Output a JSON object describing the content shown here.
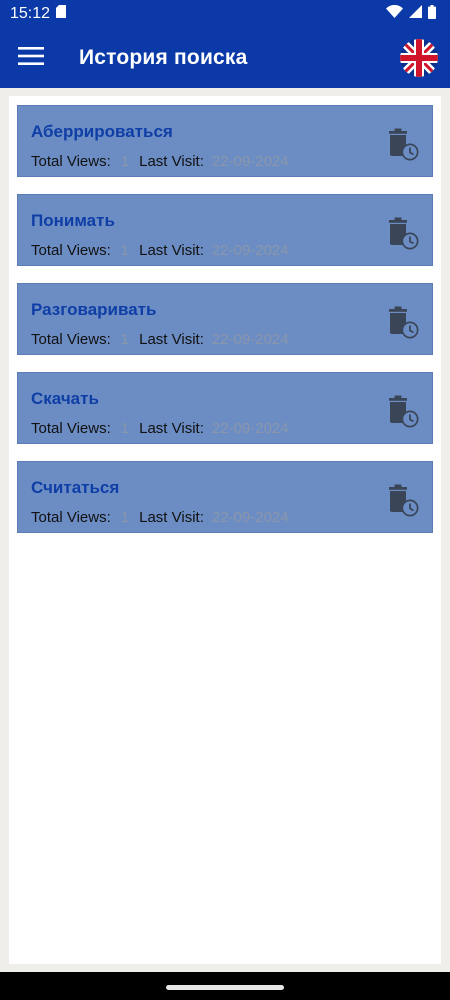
{
  "status_bar": {
    "time": "15:12",
    "sim_icon": "sd-card-icon",
    "wifi_icon": "wifi-icon",
    "signal_icon": "signal-icon",
    "battery_icon": "battery-icon"
  },
  "app_bar": {
    "title": "История поиска",
    "menu_icon": "hamburger-menu-icon",
    "language_icon": "uk-flag-icon"
  },
  "history": {
    "items": [
      {
        "word": "Аберрироваться",
        "views_label": "Total Views:",
        "views": "1",
        "visit_label": "Last Visit:",
        "last_visit": "22-09-2024"
      },
      {
        "word": "Понимать",
        "views_label": "Total Views:",
        "views": "1",
        "visit_label": "Last Visit:",
        "last_visit": "22-09-2024"
      },
      {
        "word": "Разговаривать",
        "views_label": "Total Views:",
        "views": "1",
        "visit_label": "Last Visit:",
        "last_visit": "22-09-2024"
      },
      {
        "word": "Скачать",
        "views_label": "Total Views:",
        "views": "1",
        "visit_label": "Last Visit:",
        "last_visit": "22-09-2024"
      },
      {
        "word": "Считаться",
        "views_label": "Total Views:",
        "views": "1",
        "visit_label": "Last Visit:",
        "last_visit": "22-09-2024"
      }
    ],
    "delete_icon": "delete-history-icon"
  },
  "colors": {
    "primary": "#0b3aa8",
    "card_bg": "#6c8dc4",
    "card_title": "#0e3ea6",
    "muted_value": "#8a96aa",
    "page_bg": "#f0eeea"
  }
}
